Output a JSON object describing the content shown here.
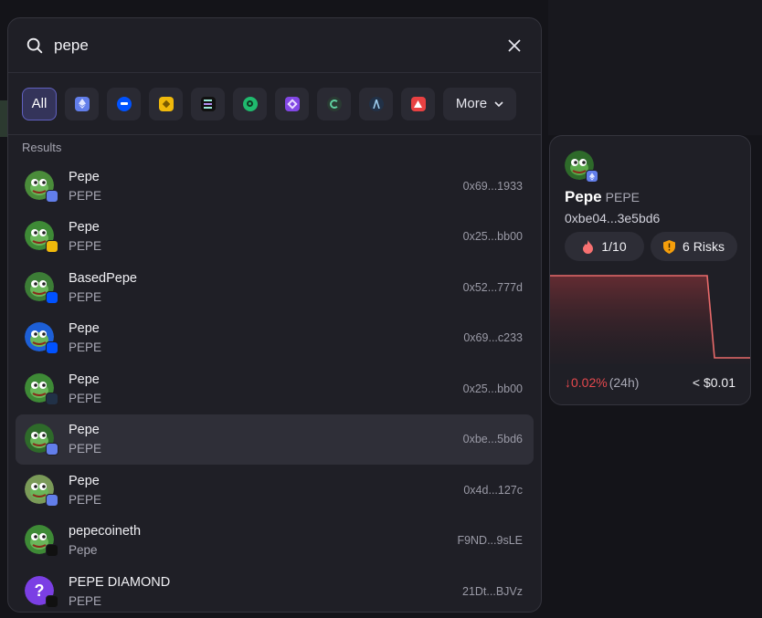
{
  "search": {
    "value": "pepe"
  },
  "chains": {
    "all_label": "All",
    "more_label": "More",
    "items": [
      {
        "icon": "ethereum-icon",
        "color": "#627eea"
      },
      {
        "icon": "base-icon",
        "color": "#0052ff"
      },
      {
        "icon": "bnb-icon",
        "color": "#f0b90b"
      },
      {
        "icon": "solana-icon",
        "color": "#111111"
      },
      {
        "icon": "bitcoin-icon",
        "color": "#1fba6e"
      },
      {
        "icon": "polygon-icon",
        "color": "#8247e5"
      },
      {
        "icon": "sui-icon",
        "color": "#2a3a33"
      },
      {
        "icon": "arbitrum-icon",
        "color": "#213147"
      },
      {
        "icon": "avalanche-icon",
        "color": "#e84142"
      }
    ]
  },
  "results": {
    "label": "Results",
    "items": [
      {
        "name": "Pepe",
        "symbol": "PEPE",
        "address": "0x69...1933",
        "chain": "ethereum",
        "face": "#4a8c3a",
        "selected": false
      },
      {
        "name": "Pepe",
        "symbol": "PEPE",
        "address": "0x25...bb00",
        "chain": "bnb",
        "face": "#3e8a36",
        "selected": false
      },
      {
        "name": "BasedPepe",
        "symbol": "PEPE",
        "address": "0x52...777d",
        "chain": "base",
        "face": "#3c7d36",
        "selected": false
      },
      {
        "name": "Pepe",
        "symbol": "PEPE",
        "address": "0x69...c233",
        "chain": "base",
        "face": "#1d5fd6",
        "selected": false
      },
      {
        "name": "Pepe",
        "symbol": "PEPE",
        "address": "0x25...bb00",
        "chain": "arbitrum",
        "face": "#3e8a36",
        "selected": false
      },
      {
        "name": "Pepe",
        "symbol": "PEPE",
        "address": "0xbe...5bd6",
        "chain": "ethereum",
        "face": "#2e6a2a",
        "selected": true
      },
      {
        "name": "Pepe",
        "symbol": "PEPE",
        "address": "0x4d...127c",
        "chain": "ethereum",
        "face": "#7a9a58",
        "selected": false
      },
      {
        "name": "pepecoineth",
        "symbol": "Pepe",
        "address": "F9ND...9sLE",
        "chain": "solana",
        "face": "#3e8a36",
        "selected": false
      },
      {
        "name": "PEPE DIAMOND",
        "symbol": "PEPE",
        "address": "21Dt...BJVz",
        "chain": "solana",
        "face": "#7b3fe4",
        "selected": false
      }
    ]
  },
  "detail": {
    "name": "Pepe",
    "symbol": "PEPE",
    "address": "0xbe04...3e5bd6",
    "score": "1/10",
    "risks": "6 Risks",
    "change": "↓0.02%",
    "period": "(24h)",
    "price": "< $0.01",
    "chart_color": "#e86a6a"
  }
}
